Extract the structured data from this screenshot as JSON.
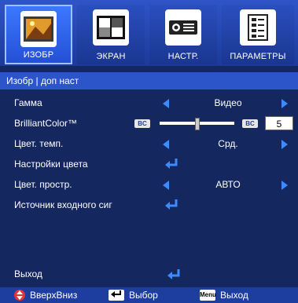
{
  "tabs": [
    {
      "label": "ИЗОБР",
      "icon": "picture-icon",
      "active": true
    },
    {
      "label": "ЭКРАН",
      "icon": "screen-icon",
      "active": false
    },
    {
      "label": "НАСТР.",
      "icon": "projector-icon",
      "active": false
    },
    {
      "label": "ПАРАМЕТРЫ",
      "icon": "document-icon",
      "active": false
    }
  ],
  "breadcrumb": "Изобр | доп наст",
  "rows": {
    "gamma": {
      "label": "Гамма",
      "value": "Видео"
    },
    "brilliant": {
      "label": "BrilliantColor™",
      "left_box": "BC",
      "right_box": "BC",
      "value": "5",
      "level_fraction": 0.5
    },
    "color_temp": {
      "label": "Цвет. темп.",
      "value": "Срд."
    },
    "color_settings": {
      "label": "Настройки цвета"
    },
    "color_space": {
      "label": "Цвет. простр.",
      "value": "АВТО"
    },
    "input_source": {
      "label": "Источник входного сиг"
    }
  },
  "exit": {
    "label": "Выход"
  },
  "footer": {
    "updown": "ВверхВниз",
    "select": "Выбор",
    "menu_key": "Menu",
    "exit": "Выход"
  },
  "colors": {
    "accent": "#3c8bff",
    "titlebar": "#2b55c9",
    "background": "#14275f"
  }
}
